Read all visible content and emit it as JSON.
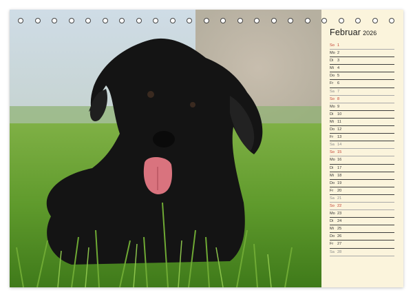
{
  "calendar": {
    "month": "Februar",
    "year": "2026",
    "days": [
      {
        "abbr": "So",
        "num": "1",
        "type": "holiday"
      },
      {
        "abbr": "Mo",
        "num": "2",
        "type": "weekday"
      },
      {
        "abbr": "Di",
        "num": "3",
        "type": "weekday"
      },
      {
        "abbr": "Mi",
        "num": "4",
        "type": "weekday"
      },
      {
        "abbr": "Do",
        "num": "5",
        "type": "weekday"
      },
      {
        "abbr": "Fr",
        "num": "6",
        "type": "weekday"
      },
      {
        "abbr": "Sa",
        "num": "7",
        "type": "weekend"
      },
      {
        "abbr": "So",
        "num": "8",
        "type": "holiday"
      },
      {
        "abbr": "Mo",
        "num": "9",
        "type": "weekday"
      },
      {
        "abbr": "Di",
        "num": "10",
        "type": "weekday"
      },
      {
        "abbr": "Mi",
        "num": "11",
        "type": "weekday"
      },
      {
        "abbr": "Do",
        "num": "12",
        "type": "weekday"
      },
      {
        "abbr": "Fr",
        "num": "13",
        "type": "weekday"
      },
      {
        "abbr": "Sa",
        "num": "14",
        "type": "weekend"
      },
      {
        "abbr": "So",
        "num": "15",
        "type": "holiday"
      },
      {
        "abbr": "Mo",
        "num": "16",
        "type": "weekday"
      },
      {
        "abbr": "Di",
        "num": "17",
        "type": "weekday"
      },
      {
        "abbr": "Mi",
        "num": "18",
        "type": "weekday"
      },
      {
        "abbr": "Do",
        "num": "19",
        "type": "weekday"
      },
      {
        "abbr": "Fr",
        "num": "20",
        "type": "weekday"
      },
      {
        "abbr": "Sa",
        "num": "21",
        "type": "weekend"
      },
      {
        "abbr": "So",
        "num": "22",
        "type": "holiday"
      },
      {
        "abbr": "Mo",
        "num": "23",
        "type": "weekday"
      },
      {
        "abbr": "Di",
        "num": "24",
        "type": "weekday"
      },
      {
        "abbr": "Mi",
        "num": "25",
        "type": "weekday"
      },
      {
        "abbr": "Do",
        "num": "26",
        "type": "weekday"
      },
      {
        "abbr": "Fr",
        "num": "27",
        "type": "weekday"
      },
      {
        "abbr": "Sa",
        "num": "28",
        "type": "weekend"
      }
    ]
  },
  "colors": {
    "sidebar_bg": "#fbf4dc",
    "holiday_text": "#c0392b",
    "weekend_text": "#888888",
    "grass": "#5f9a2c",
    "sky": "#c9d6df",
    "dog": "#141414",
    "tongue": "#d9737e"
  },
  "photo": {
    "subject_icon": "black-dog-photo"
  }
}
